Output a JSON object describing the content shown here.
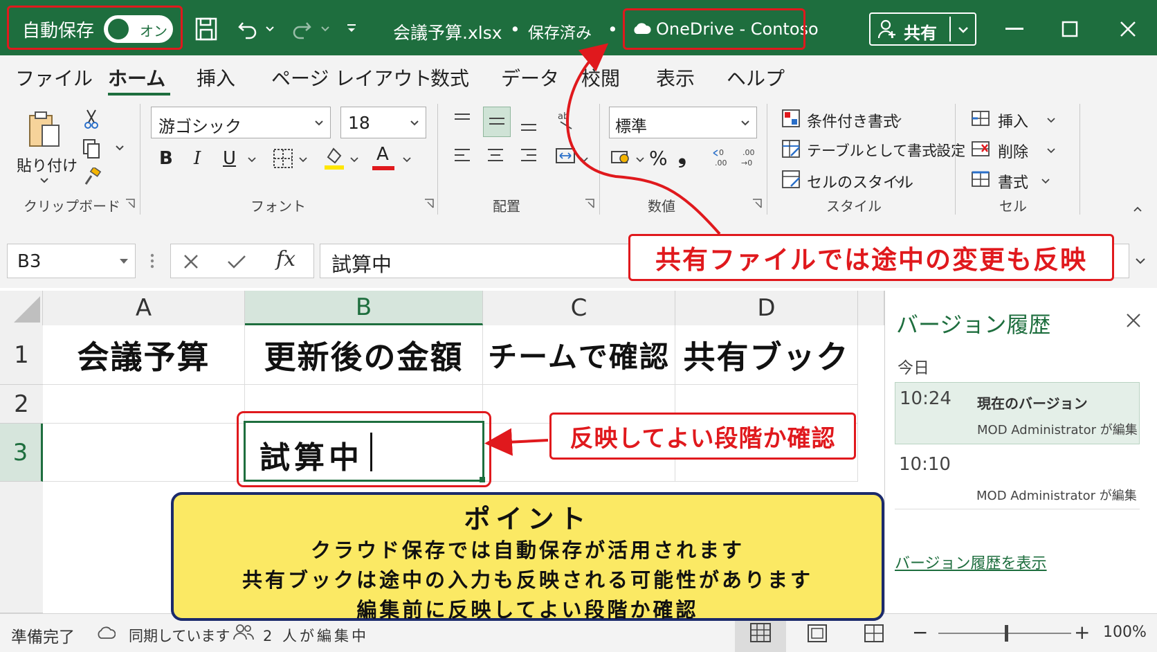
{
  "titlebar": {
    "autosave_label": "自動保存",
    "autosave_state": "オン",
    "filename": "会議予算.xlsx",
    "save_status": "保存済み",
    "bullet": "•",
    "location": "OneDrive - Contoso",
    "share_label": "共有",
    "icons": [
      "save-icon",
      "undo-icon",
      "redo-icon",
      "customize-icon",
      "minimize-icon",
      "maximize-icon",
      "close-icon"
    ]
  },
  "menu": {
    "tabs": [
      "ファイル",
      "ホーム",
      "挿入",
      "ページ レイアウト",
      "数式",
      "データ",
      "校閲",
      "表示",
      "ヘルプ"
    ],
    "active_tab": "ホーム"
  },
  "ribbon": {
    "clipboard": {
      "paste_label": "貼り付け",
      "group_label": "クリップボード"
    },
    "font": {
      "font_name": "游ゴシック",
      "font_size": "18",
      "bold": "B",
      "italic": "I",
      "underline": "U",
      "font_color_glyph": "A",
      "group_label": "フォント"
    },
    "alignment": {
      "group_label": "配置"
    },
    "number": {
      "format": "標準",
      "percent": "%",
      "comma": "❟",
      "group_label": "数値"
    },
    "styles": {
      "items": [
        "条件付き書式",
        "テーブルとして書式設定",
        "セルのスタイル"
      ],
      "group_label": "スタイル"
    },
    "cells": {
      "items": [
        "挿入",
        "削除",
        "書式"
      ],
      "group_label": "セル"
    }
  },
  "formula_bar": {
    "name_box": "B3",
    "fx": "fx",
    "content": "試算中"
  },
  "sheet": {
    "columns": [
      "A",
      "B",
      "C",
      "D"
    ],
    "rows": [
      "1",
      "2",
      "3"
    ],
    "row1": [
      "会議予算",
      "更新後の金額",
      "チームで確認",
      "共有ブック"
    ],
    "b3": "試算中"
  },
  "version_panel": {
    "title": "バージョン履歴",
    "today": "今日",
    "entries": [
      {
        "time": "10:24",
        "label": "現在のバージョン",
        "editor": "MOD Administrator が編集"
      },
      {
        "time": "10:10",
        "label": "",
        "editor": "MOD Administrator が編集"
      }
    ],
    "link": "バージョン履歴を表示"
  },
  "status": {
    "ready": "準備完了",
    "sync": "同期しています",
    "editing": "2 人が編集中",
    "zoom": "100%"
  },
  "callouts": {
    "top": "共有ファイルでは途中の変更も反映",
    "cell": "反映してよい段階か確認",
    "point_title": "ポイント",
    "point_lines": [
      "クラウド保存では自動保存が活用されます",
      "共有ブックは途中の入力も反映される可能性があります",
      "編集前に反映してよい段階か確認"
    ]
  },
  "colors": {
    "excel_green": "#1e6e3e",
    "callout_red": "#e0191d",
    "point_yellow": "#fbe964",
    "point_border": "#1b2a6b"
  }
}
